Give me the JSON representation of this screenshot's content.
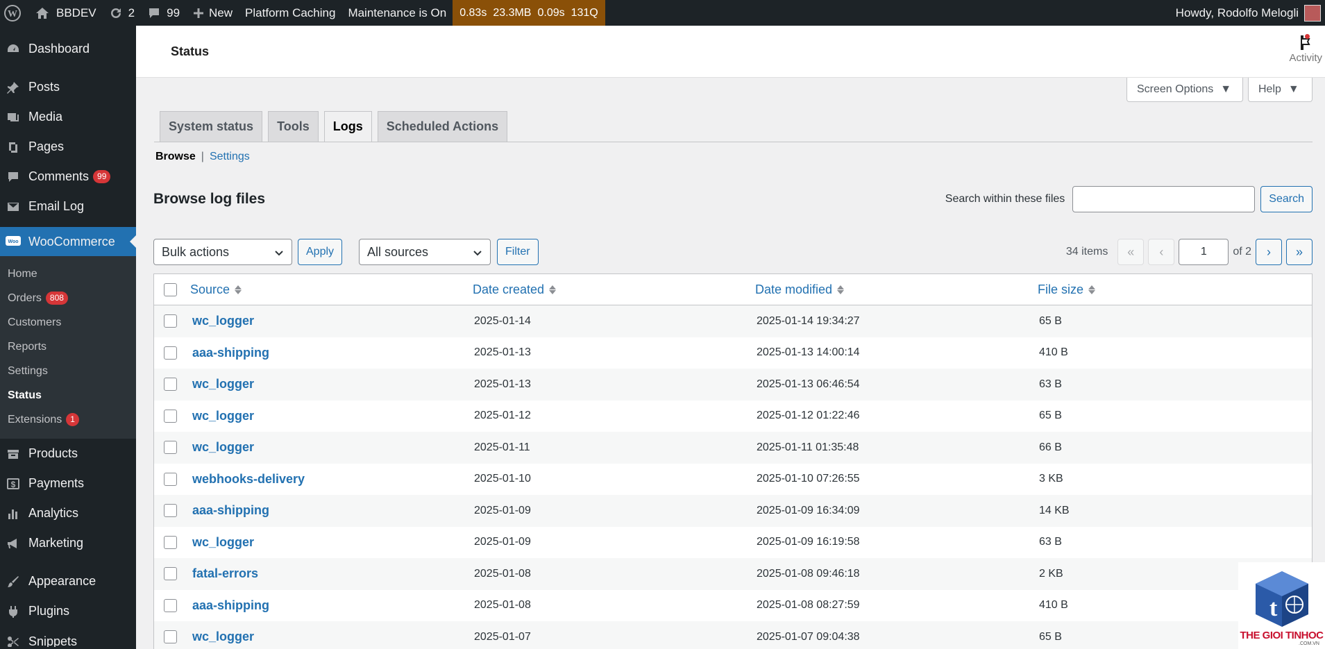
{
  "adminbar": {
    "site_name": "BBDEV",
    "updates": "2",
    "comments": "99",
    "new_label": "New",
    "platform_caching": "Platform Caching",
    "maintenance": "Maintenance is On",
    "perf_time": "0.83s",
    "perf_mem": "23.3MB",
    "perf_query_time": "0.09s",
    "perf_queries": "131Q",
    "howdy": "Howdy, Rodolfo Melogli"
  },
  "sidebar": {
    "dashboard": "Dashboard",
    "posts": "Posts",
    "media": "Media",
    "pages": "Pages",
    "comments": "Comments",
    "comments_badge": "99",
    "email_log": "Email Log",
    "woocommerce": "WooCommerce",
    "sub": {
      "home": "Home",
      "orders": "Orders",
      "orders_badge": "808",
      "customers": "Customers",
      "reports": "Reports",
      "settings": "Settings",
      "status": "Status",
      "extensions": "Extensions",
      "extensions_badge": "1"
    },
    "products": "Products",
    "payments": "Payments",
    "analytics": "Analytics",
    "marketing": "Marketing",
    "appearance": "Appearance",
    "plugins": "Plugins",
    "snippets": "Snippets"
  },
  "header": {
    "title": "Status",
    "activity": "Activity"
  },
  "screen_options": "Screen Options",
  "help": "Help",
  "tabs": [
    "System status",
    "Tools",
    "Logs",
    "Scheduled Actions"
  ],
  "subnav": {
    "browse": "Browse",
    "separator": "|",
    "settings": "Settings"
  },
  "heading": "Browse log files",
  "search": {
    "label": "Search within these files",
    "value": "",
    "button": "Search"
  },
  "tablenav": {
    "bulk_actions": "Bulk actions",
    "apply": "Apply",
    "sources": "All sources",
    "filter": "Filter",
    "items": "34 items",
    "first": "«",
    "prev": "‹",
    "page": "1",
    "of": "of 2",
    "next": "›",
    "last": "»"
  },
  "table": {
    "headers": [
      "Source",
      "Date created",
      "Date modified",
      "File size"
    ],
    "rows": [
      {
        "source": "wc_logger",
        "created": "2025-01-14",
        "modified": "2025-01-14 19:34:27",
        "size": "65 B"
      },
      {
        "source": "aaa-shipping",
        "created": "2025-01-13",
        "modified": "2025-01-13 14:00:14",
        "size": "410 B"
      },
      {
        "source": "wc_logger",
        "created": "2025-01-13",
        "modified": "2025-01-13 06:46:54",
        "size": "63 B"
      },
      {
        "source": "wc_logger",
        "created": "2025-01-12",
        "modified": "2025-01-12 01:22:46",
        "size": "65 B"
      },
      {
        "source": "wc_logger",
        "created": "2025-01-11",
        "modified": "2025-01-11 01:35:48",
        "size": "66 B"
      },
      {
        "source": "webhooks-delivery",
        "created": "2025-01-10",
        "modified": "2025-01-10 07:26:55",
        "size": "3 KB"
      },
      {
        "source": "aaa-shipping",
        "created": "2025-01-09",
        "modified": "2025-01-09 16:34:09",
        "size": "14 KB"
      },
      {
        "source": "wc_logger",
        "created": "2025-01-09",
        "modified": "2025-01-09 16:19:58",
        "size": "63 B"
      },
      {
        "source": "fatal-errors",
        "created": "2025-01-08",
        "modified": "2025-01-08 09:46:18",
        "size": "2 KB"
      },
      {
        "source": "aaa-shipping",
        "created": "2025-01-08",
        "modified": "2025-01-08 08:27:59",
        "size": "410 B"
      },
      {
        "source": "wc_logger",
        "created": "2025-01-07",
        "modified": "2025-01-07 09:04:38",
        "size": "65 B"
      }
    ]
  },
  "watermark": {
    "text": "THE GIOI TINHOC",
    "sub": ".COM.VN"
  },
  "colors": {
    "accent": "#2271b1",
    "adminbar": "#1d2327",
    "badge": "#d63638",
    "perf": "#8a5008"
  }
}
